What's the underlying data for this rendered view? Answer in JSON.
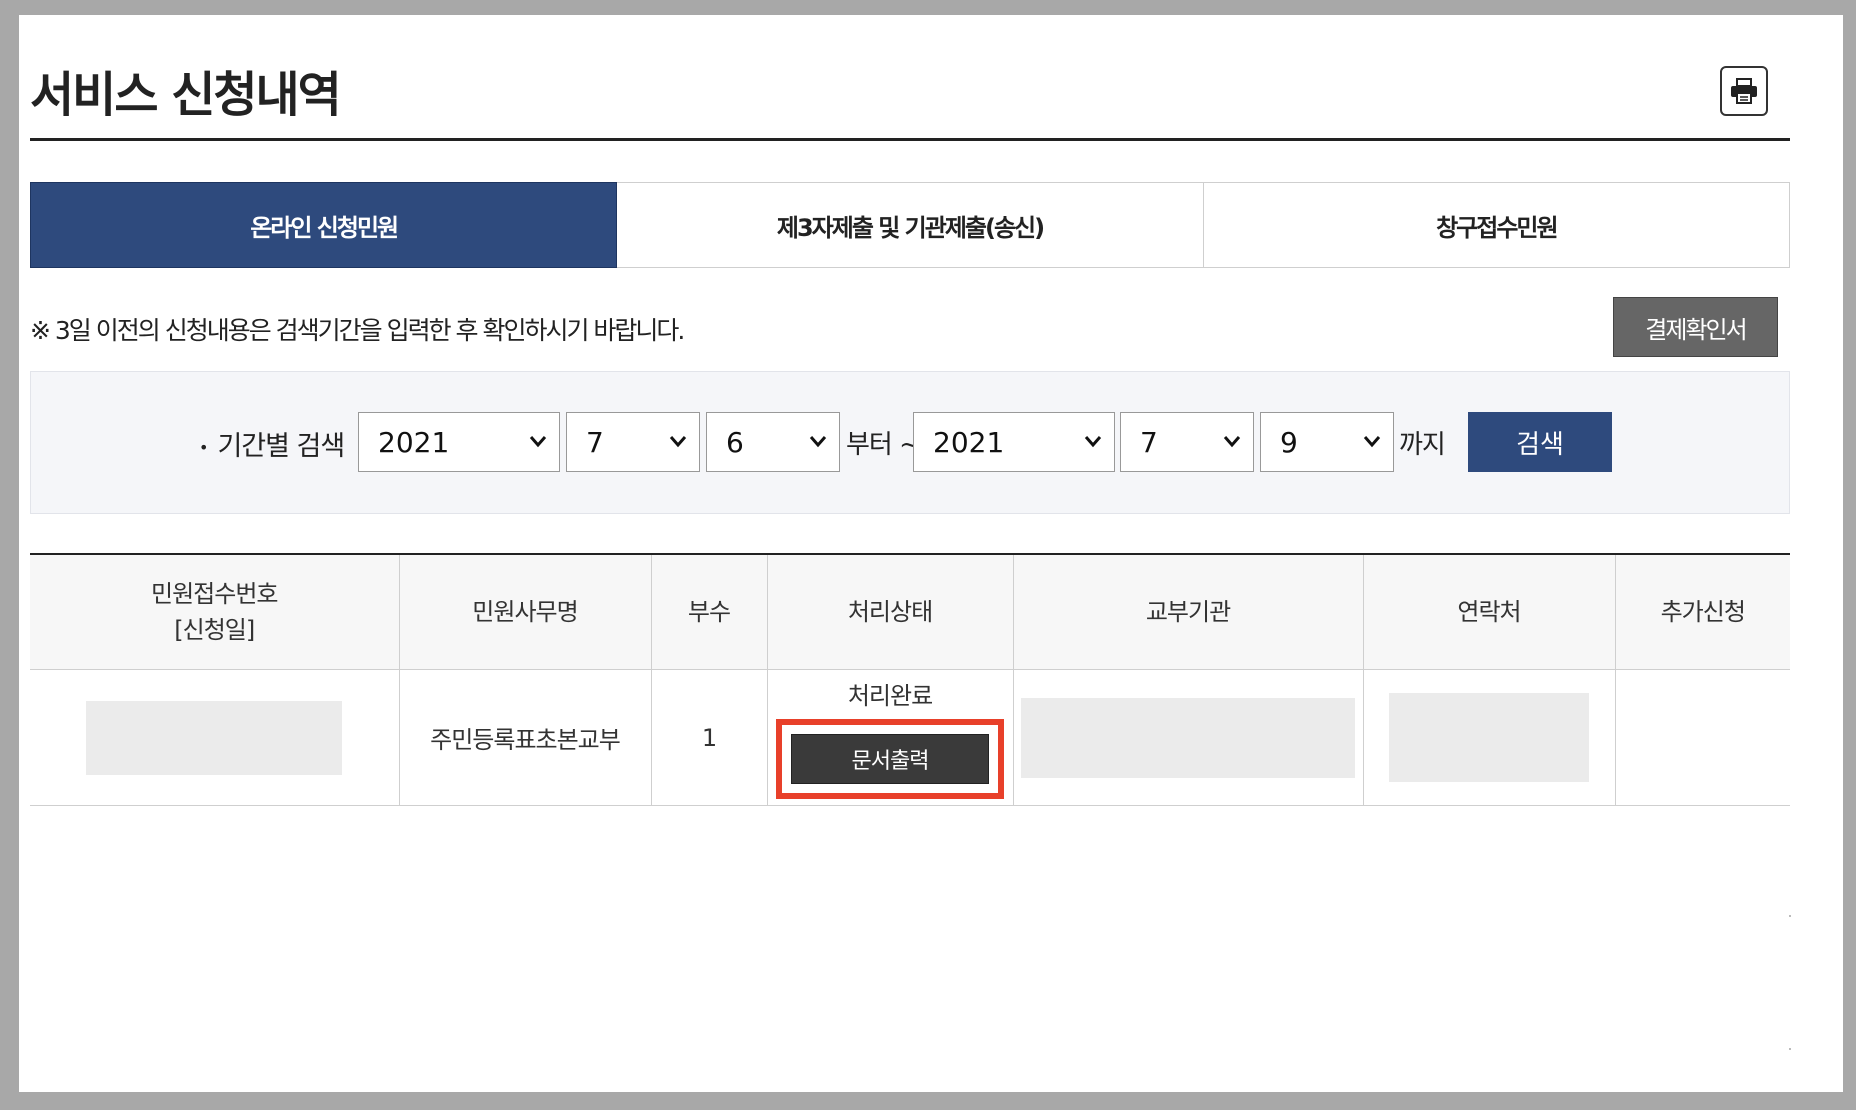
{
  "page": {
    "title": "서비스 신청내역",
    "print_icon": "printer-icon"
  },
  "tabs": [
    {
      "label": "온라인 신청민원",
      "active": true
    },
    {
      "label": "제3자제출 및 기관제출(송신)",
      "active": false
    },
    {
      "label": "창구접수민원",
      "active": false
    }
  ],
  "notice": "※ 3일 이전의 신청내용은 검색기간을 입력한 후 확인하시기 바랍니다.",
  "receipt_button": "결제확인서",
  "search": {
    "label": "기간별 검색",
    "from_year": "2021",
    "from_month": "7",
    "from_day": "6",
    "from_text": "부터 ~",
    "to_year": "2021",
    "to_month": "7",
    "to_day": "9",
    "to_text": "까지",
    "button": "검색"
  },
  "table": {
    "headers": [
      "민원접수번호",
      "[신청일]",
      "민원사무명",
      "부수",
      "처리상태",
      "교부기관",
      "연락처",
      "추가신청"
    ],
    "rows": [
      {
        "receipt_no": "",
        "service_name": "주민등록표초본교부",
        "copies": "1",
        "status": "처리완료",
        "action_button": "문서출력",
        "agency": "",
        "contact": "",
        "additional": ""
      }
    ]
  },
  "colors": {
    "primary": "#2e4a7d",
    "highlight": "#e8402a",
    "dark_button": "#3a3a3a",
    "gray_button": "#666666"
  }
}
